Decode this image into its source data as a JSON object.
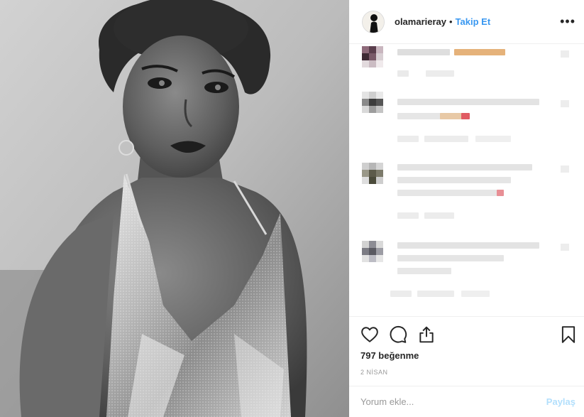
{
  "header": {
    "username": "olamarieray",
    "separator": "•",
    "follow_label": "Takip Et",
    "more_icon": "more-horizontal-icon"
  },
  "post": {
    "likes": "797 beğenme",
    "date": "2 NİSAN"
  },
  "comment_box": {
    "placeholder": "Yorum ekle...",
    "post_label": "Paylaş"
  },
  "icons": [
    "heart-icon",
    "comment-icon",
    "share-icon",
    "bookmark-icon"
  ],
  "colors": {
    "accent": "#3897f0",
    "post_disabled": "#b2dffc",
    "text": "#262626",
    "muted": "#999999",
    "divider": "#efefef"
  }
}
